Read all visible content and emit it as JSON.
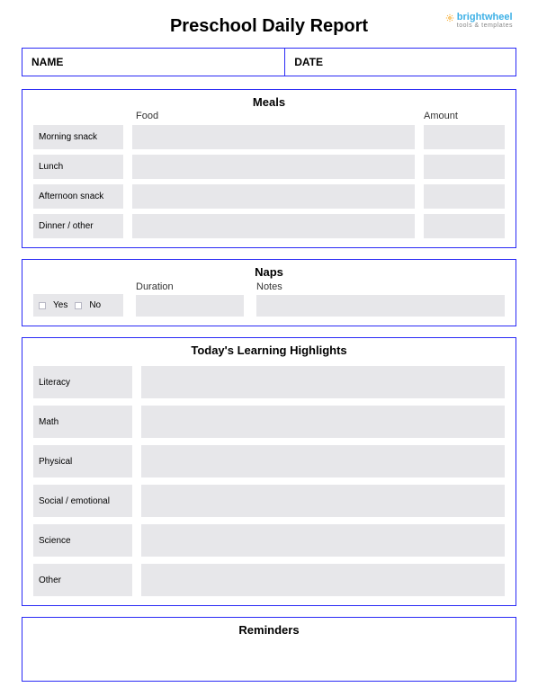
{
  "brand": {
    "name": "brightwheel",
    "tagline": "tools & templates"
  },
  "title": "Preschool Daily Report",
  "header": {
    "name_label": "NAME",
    "date_label": "DATE"
  },
  "meals": {
    "title": "Meals",
    "col_food": "Food",
    "col_amount": "Amount",
    "rows": [
      {
        "label": "Morning snack"
      },
      {
        "label": "Lunch"
      },
      {
        "label": "Afternoon snack"
      },
      {
        "label": "Dinner / other"
      }
    ]
  },
  "naps": {
    "title": "Naps",
    "col_duration": "Duration",
    "col_notes": "Notes",
    "yes": "Yes",
    "no": "No"
  },
  "highlights": {
    "title": "Today's Learning Highlights",
    "rows": [
      {
        "label": "Literacy"
      },
      {
        "label": "Math"
      },
      {
        "label": "Physical"
      },
      {
        "label": "Social / emotional"
      },
      {
        "label": "Science"
      },
      {
        "label": "Other"
      }
    ]
  },
  "reminders": {
    "title": "Reminders"
  }
}
